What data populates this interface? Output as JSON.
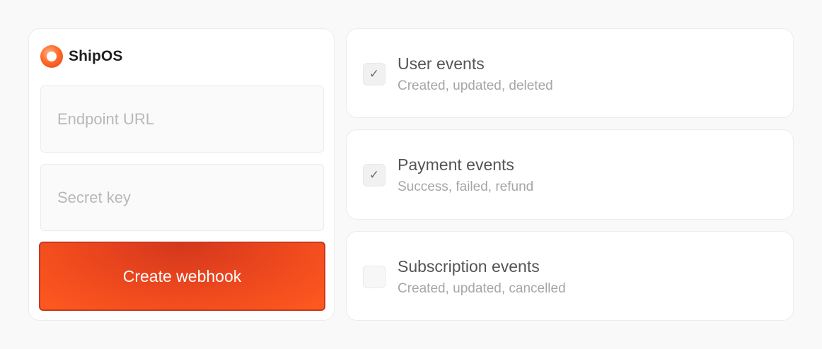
{
  "brand": {
    "name": "ShipOS",
    "icon": "logo-ring-icon"
  },
  "form": {
    "endpoint_placeholder": "Endpoint URL",
    "endpoint_value": "",
    "secret_placeholder": "Secret key",
    "secret_value": "",
    "submit_label": "Create webhook"
  },
  "events": [
    {
      "title": "User events",
      "description": "Created, updated, deleted",
      "checked": true
    },
    {
      "title": "Payment events",
      "description": "Success, failed, refund",
      "checked": true
    },
    {
      "title": "Subscription events",
      "description": "Created, updated, cancelled",
      "checked": false
    }
  ],
  "colors": {
    "accent": "#ff5a1f",
    "accent_dark": "#c8381e",
    "background": "#f9f9f9"
  }
}
